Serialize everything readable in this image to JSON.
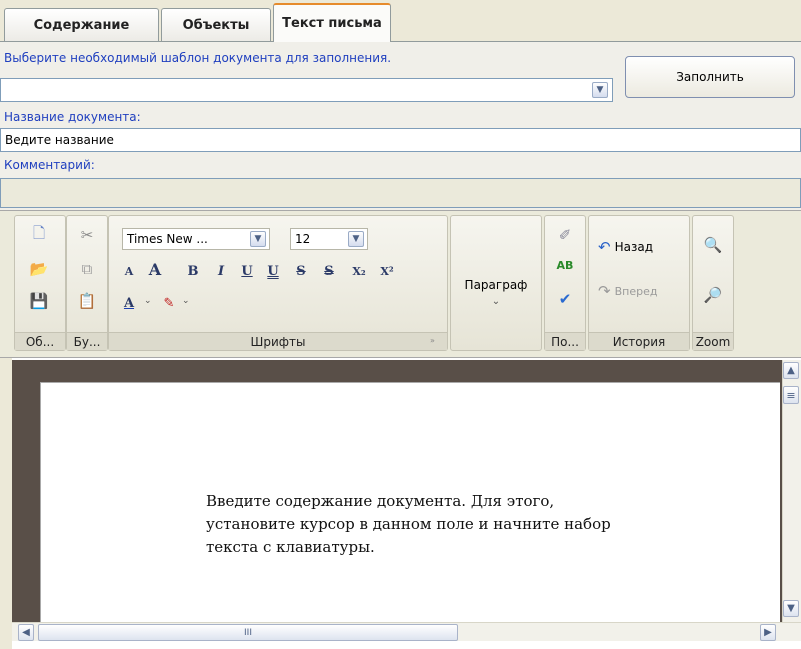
{
  "tabs": [
    {
      "label": "Содержание",
      "active": false
    },
    {
      "label": "Объекты",
      "active": false
    },
    {
      "label": "Текст письма",
      "active": true
    }
  ],
  "form": {
    "template_label": "Выберите необходимый шаблон документа для заполнения.",
    "template_value": "",
    "fill_button": "Заполнить",
    "doc_name_label": "Название документа:",
    "doc_name_value": "Ведите название",
    "comment_label": "Комментарий:",
    "comment_value": ""
  },
  "ribbon": {
    "groups": {
      "objects": "Об...",
      "buffer": "Бу...",
      "fonts": "Шрифты",
      "paragraph": "Параграф",
      "proof": "По...",
      "history": "История",
      "zoom": "Zoom"
    },
    "font_name": "Times New ...",
    "font_size": "12",
    "format_buttons": [
      "A",
      "A",
      "B",
      "I",
      "U",
      "U",
      "S",
      "S",
      "X₂",
      "X²"
    ],
    "undo": "Назад",
    "redo": "Вперед"
  },
  "editor": {
    "lines": [
      "Введите содержание документа. Для этого,",
      "установите курсор в данном поле и начните набор",
      "текста с клавиатуры."
    ]
  },
  "scroll": {
    "thumb_grip": "III"
  },
  "colors": {
    "label_blue": "#1f3fbf",
    "tab_accent": "#e68b2c",
    "editor_bg": "#594f48"
  }
}
